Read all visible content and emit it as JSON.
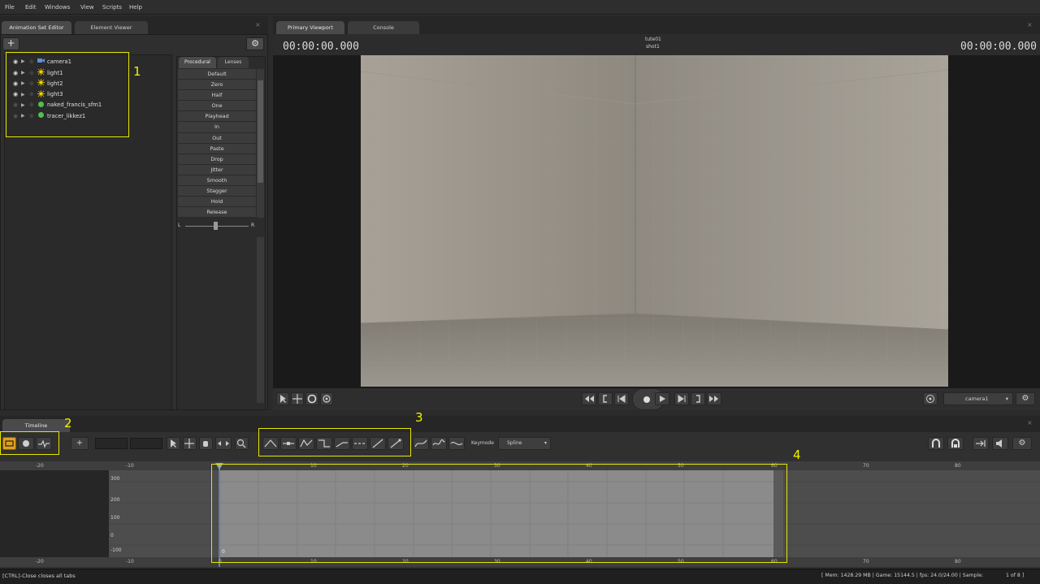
{
  "menu": [
    "File",
    "Edit",
    "Windows",
    "View",
    "Scripts",
    "Help"
  ],
  "left_tabs": {
    "tab1": "Animation Set Editor",
    "tab2": "Element Viewer"
  },
  "tree": [
    {
      "label": "camera1",
      "type": "camera"
    },
    {
      "label": "light1",
      "type": "light"
    },
    {
      "label": "light2",
      "type": "light"
    },
    {
      "label": "light3",
      "type": "light"
    },
    {
      "label": "naked_francis_sfm1",
      "type": "model"
    },
    {
      "label": "tracer_likkez1",
      "type": "model"
    }
  ],
  "proc_tabs": {
    "procedural": "Procedural",
    "lenses": "Lenses"
  },
  "proc_items": [
    "Default",
    "Zero",
    "Half",
    "One",
    "Playhead",
    "In",
    "Out",
    "Paste",
    "Drop",
    "Jitter",
    "Smooth",
    "Stagger",
    "Hold",
    "Release"
  ],
  "slider": {
    "left": "L",
    "right": "R"
  },
  "viewport_tabs": {
    "tab1": "Primary Viewport",
    "tab2": "Console"
  },
  "viewport": {
    "time_left": "00:00:00.000",
    "time_right": "00:00:00.000",
    "shot_line1": "tute01",
    "shot_line2": "shot1",
    "camera": "camera1"
  },
  "timeline": {
    "tab": "Timeline",
    "keymode_label": "Keymode",
    "keymode_value": "Spline",
    "playhead_value": "0",
    "ticks_top": [
      "-20",
      "-10",
      "0",
      "10",
      "20",
      "30",
      "40",
      "50",
      "60",
      "70",
      "80"
    ],
    "ticks_bottom": [
      "-20",
      "-10",
      "0",
      "10",
      "20",
      "30",
      "40",
      "50",
      "60",
      "70",
      "80"
    ],
    "y_labels": [
      "300",
      "200",
      "100",
      "0",
      "-100"
    ]
  },
  "annotations": {
    "a1": "1",
    "a2": "2",
    "a3": "3",
    "a4": "4"
  },
  "status": {
    "left": "[CTRL]-Close closes all tabs",
    "mem": "[ Mem:  1428.29 MB | Game:  15144.5 | fps:   24.0/24.00 | Sample:",
    "page": "1 of 8 ]"
  },
  "colors": {
    "accent": "#f0a020",
    "annotation": "#e6e600"
  }
}
